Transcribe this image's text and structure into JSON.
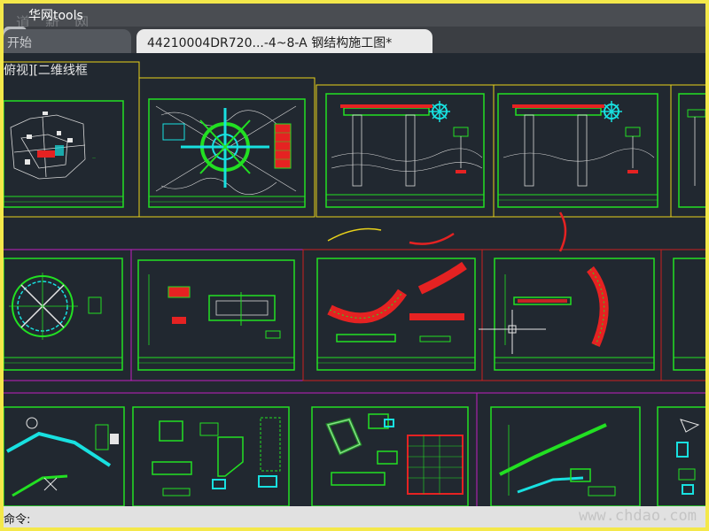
{
  "window": {
    "title": "华网tools",
    "watermark_top": "道 新 网"
  },
  "tabs": [
    {
      "label": "开始",
      "active": false
    },
    {
      "label": "44210004DR720...-4~8-A 钢结构施工图*",
      "active": true
    }
  ],
  "add_tab_label": "+",
  "viewport": {
    "label": "俯视][二维线框"
  },
  "command_line": {
    "label": "命令:",
    "watermark": "www.chdao.com"
  },
  "colors": {
    "canvas": "#212830",
    "sheet_border": "#22e022",
    "drawing_accent": "#e52222",
    "highlight": "#18e0e0",
    "layout_yellow": "#e9d21a",
    "layout_magenta": "#c21fc2",
    "selection_frame": "#cc1f1f"
  }
}
